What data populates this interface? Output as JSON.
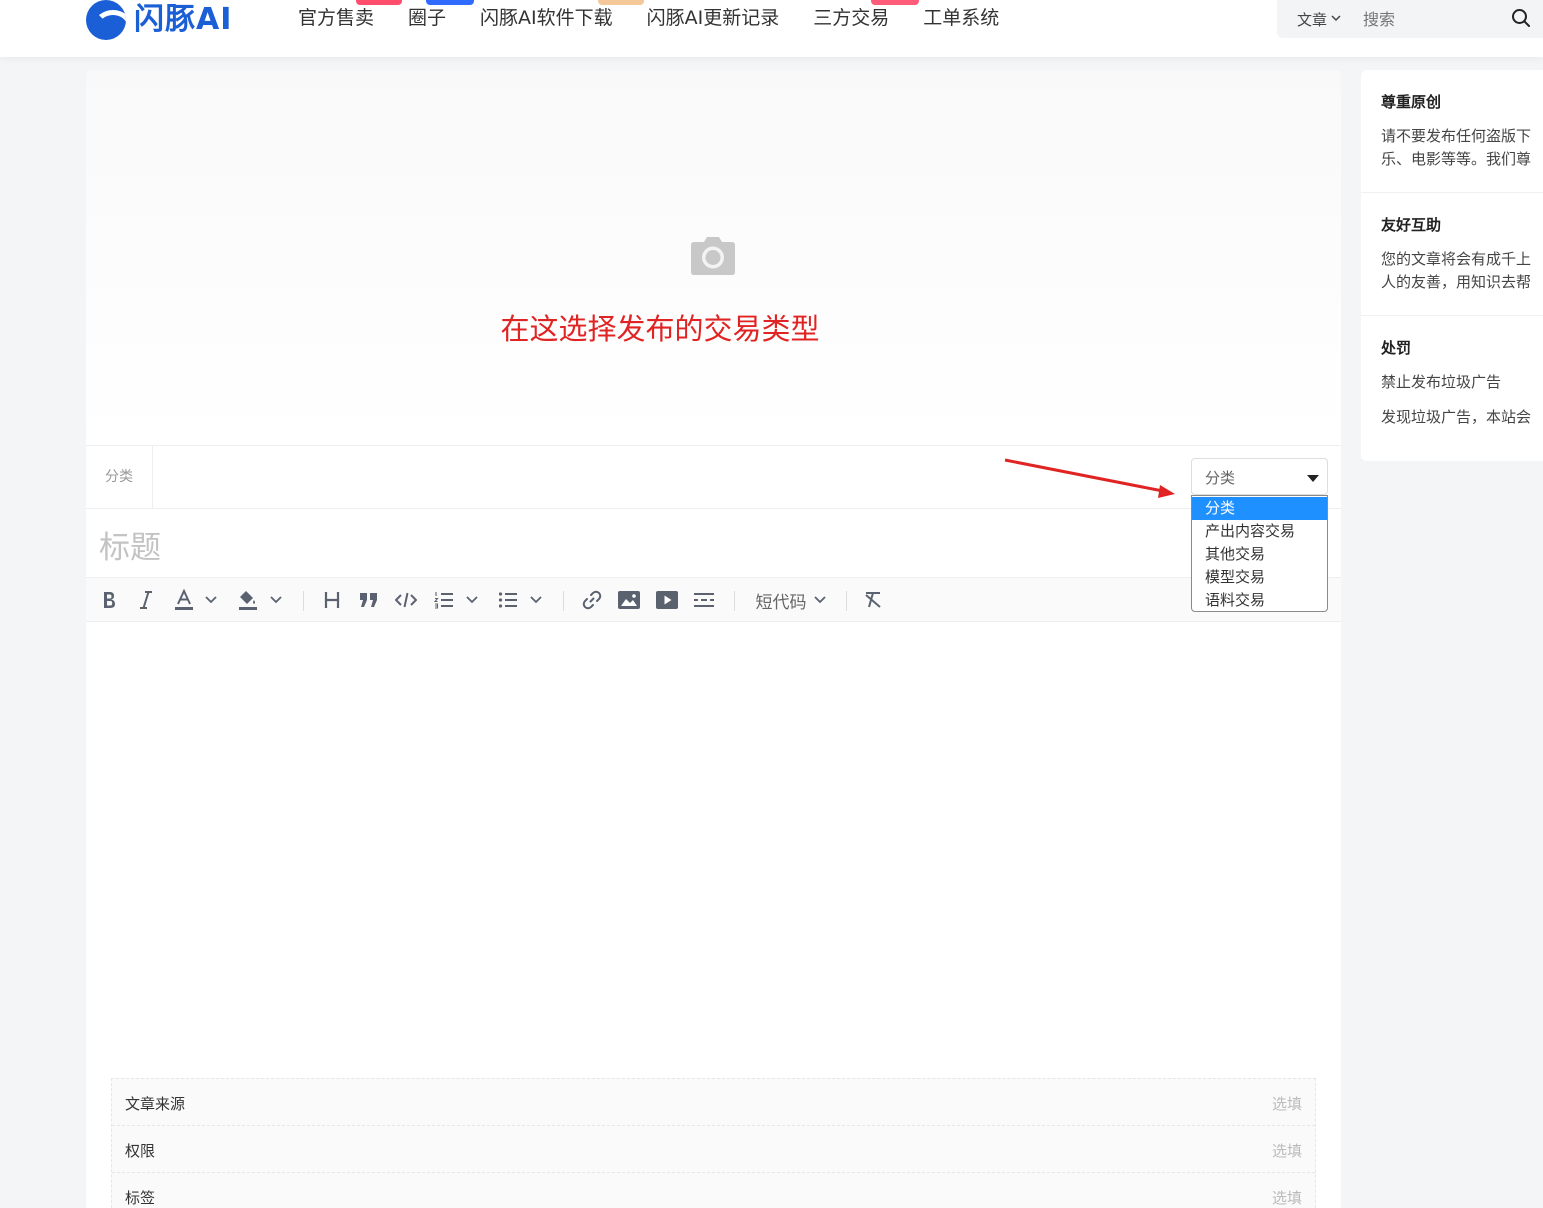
{
  "header": {
    "logo_text": "闪豚AI",
    "nav": [
      {
        "label": "官方售卖",
        "badge_color": "#ff4d6d"
      },
      {
        "label": "圈子",
        "badge_color": "#2f6bff"
      },
      {
        "label": "闪豚AI软件下载",
        "badge_color": "#f5c89a"
      },
      {
        "label": "闪豚AI更新记录",
        "badge_color": ""
      },
      {
        "label": "三方交易",
        "badge_color": "#ff5c7a"
      },
      {
        "label": "工单系统",
        "badge_color": ""
      }
    ],
    "search": {
      "type": "文章",
      "placeholder": "搜索"
    }
  },
  "editor": {
    "annotation": "在这选择发布的交易类型",
    "category_label": "分类",
    "title_placeholder": "标题",
    "toolbar": {
      "shortcode": "短代码"
    },
    "select": {
      "value": "分类",
      "options": [
        "分类",
        "产出内容交易",
        "其他交易",
        "模型交易",
        "语料交易"
      ],
      "selected_index": 0
    },
    "meta": [
      {
        "label": "文章来源",
        "hint": "选填"
      },
      {
        "label": "权限",
        "hint": "选填"
      },
      {
        "label": "标签",
        "hint": "选填"
      }
    ]
  },
  "sidebar": {
    "sections": [
      {
        "title": "尊重原创",
        "lines": [
          "请不要发布任何盗版下",
          "乐、电影等等。我们尊"
        ]
      },
      {
        "title": "友好互助",
        "lines": [
          "您的文章将会有成千上",
          "人的友善，用知识去帮"
        ]
      },
      {
        "title": "处罚",
        "lines": [
          "禁止发布垃圾广告",
          "发现垃圾广告，本站会"
        ]
      }
    ]
  },
  "colors": {
    "brand": "#1a5fd6",
    "annotation": "#e02424",
    "selected_option": "#1e90ff"
  }
}
